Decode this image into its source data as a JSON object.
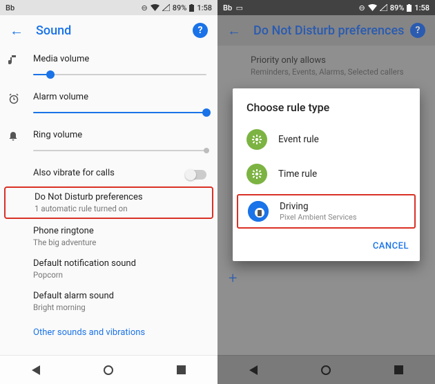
{
  "left": {
    "status": {
      "label": "Bb",
      "battery": "89%",
      "time": "1:58"
    },
    "appbar": {
      "title": "Sound"
    },
    "sliders": {
      "media": {
        "label": "Media volume",
        "pct": 10
      },
      "alarm": {
        "label": "Alarm volume",
        "pct": 100
      },
      "ring": {
        "label": "Ring volume",
        "pct": 100
      }
    },
    "items": {
      "vibrate": {
        "label": "Also vibrate for calls"
      },
      "dnd": {
        "title": "Do Not Disturb preferences",
        "sub": "1 automatic rule turned on"
      },
      "ringtone": {
        "title": "Phone ringtone",
        "sub": "The big adventure"
      },
      "notif": {
        "title": "Default notification sound",
        "sub": "Popcorn"
      },
      "alarm": {
        "title": "Default alarm sound",
        "sub": "Bright morning"
      },
      "other": "Other sounds and vibrations"
    }
  },
  "right": {
    "status": {
      "label": "Bb",
      "battery": "89%",
      "time": "1:58"
    },
    "appbar": {
      "title": "Do Not Disturb preferences"
    },
    "priority": {
      "title": "Priority only allows",
      "sub": "Reminders, Events, Alarms, Selected callers"
    },
    "dialog": {
      "title": "Choose rule type",
      "options": [
        {
          "name": "event-rule",
          "label": "Event rule",
          "sub": ""
        },
        {
          "name": "time-rule",
          "label": "Time rule",
          "sub": ""
        },
        {
          "name": "driving",
          "label": "Driving",
          "sub": "Pixel Ambient Services"
        }
      ],
      "cancel": "CANCEL"
    }
  }
}
